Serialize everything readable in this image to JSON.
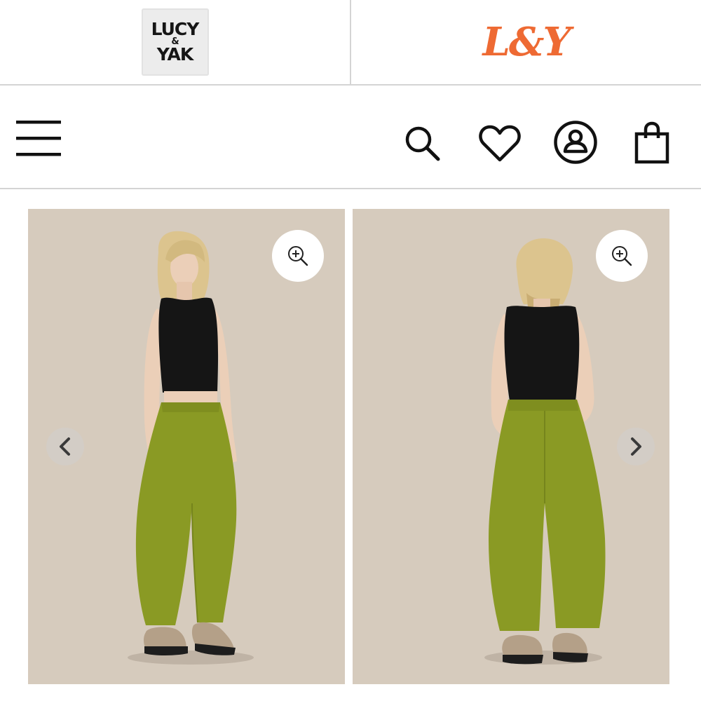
{
  "brands": {
    "lucy_and_yak": {
      "logo_lines": [
        "LUCY",
        "&",
        "YAK"
      ],
      "logo_bg": "#ececec",
      "logo_text_color": "#161616"
    },
    "l_and_y": {
      "logo_text": "L&Y",
      "logo_color": "#ee6a33"
    }
  },
  "header": {
    "icons": [
      "menu-icon",
      "search-icon",
      "heart-icon",
      "account-icon",
      "shopping-bag-icon"
    ]
  },
  "gallery": {
    "slides": [
      {
        "view": "front",
        "zoom_icon": "zoom-in-icon"
      },
      {
        "view": "back",
        "zoom_icon": "zoom-in-icon"
      }
    ],
    "prev_icon": "chevron-left-icon",
    "next_icon": "chevron-right-icon",
    "colors": {
      "backdrop": "#d6cbbd",
      "trousers": "#8a9a24",
      "top": "#151515",
      "hair": "#dcc48e",
      "skin": "#ebcfb8"
    }
  }
}
